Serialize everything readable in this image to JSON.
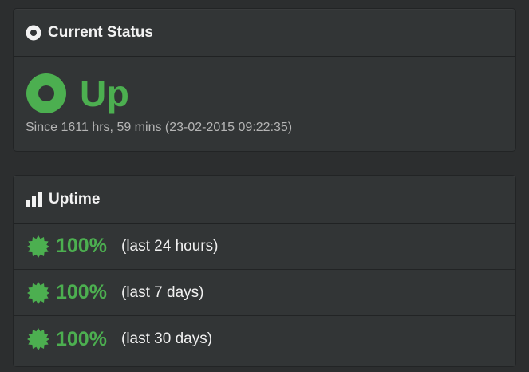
{
  "status_panel": {
    "title": "Current Status",
    "icon": "record-icon",
    "status": "Up",
    "since": "Since 1611 hrs, 59 mins (23-02-2015 09:22:35)",
    "status_color": "#4caf50"
  },
  "uptime_panel": {
    "title": "Uptime",
    "icon": "bar-chart-icon",
    "rows": [
      {
        "percent": "100%",
        "period": "(last 24 hours)",
        "icon": "certificate-icon"
      },
      {
        "percent": "100%",
        "period": "(last 7 days)",
        "icon": "certificate-icon"
      },
      {
        "percent": "100%",
        "period": "(last 30 days)",
        "icon": "certificate-icon"
      }
    ],
    "accent_color": "#4caf50"
  }
}
